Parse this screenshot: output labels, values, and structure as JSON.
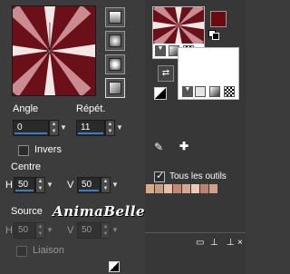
{
  "gradient": {
    "angle_label": "Angle",
    "angle_value": "0",
    "repeat_label": "Répét.",
    "repeat_value": "11",
    "invert_label": "Invers",
    "center_label": "Centre",
    "center_h_label": "H",
    "center_h_value": "50",
    "center_v_label": "V",
    "center_v_value": "50",
    "source_label": "Source",
    "source_h_label": "H",
    "source_h_value": "50",
    "source_v_label": "V",
    "source_v_value": "50",
    "link_label": "Liaison",
    "colors": {
      "dark": "#5c0a10",
      "light": "#f0e8e8"
    }
  },
  "watermark": "AnimaBelle",
  "materials": {
    "all_tools_label": "Tous les outils",
    "all_tools_checked": true,
    "foreground_color": "#6b0a10",
    "background_color": "#ffffff",
    "swatches": [
      "#d9a98a",
      "#c99a7e",
      "#e6bfa6",
      "#c28a72",
      "#d4a690",
      "#e9c9b8",
      "#b8846c",
      "#d2a088"
    ]
  },
  "icons": {
    "dropper": "eyedropper-icon",
    "add": "plus-icon",
    "swap": "swap-colors-icon",
    "reset": "reset-colors-icon",
    "pin": "pin-icon",
    "close": "close-icon",
    "dock": "dock-icon"
  }
}
